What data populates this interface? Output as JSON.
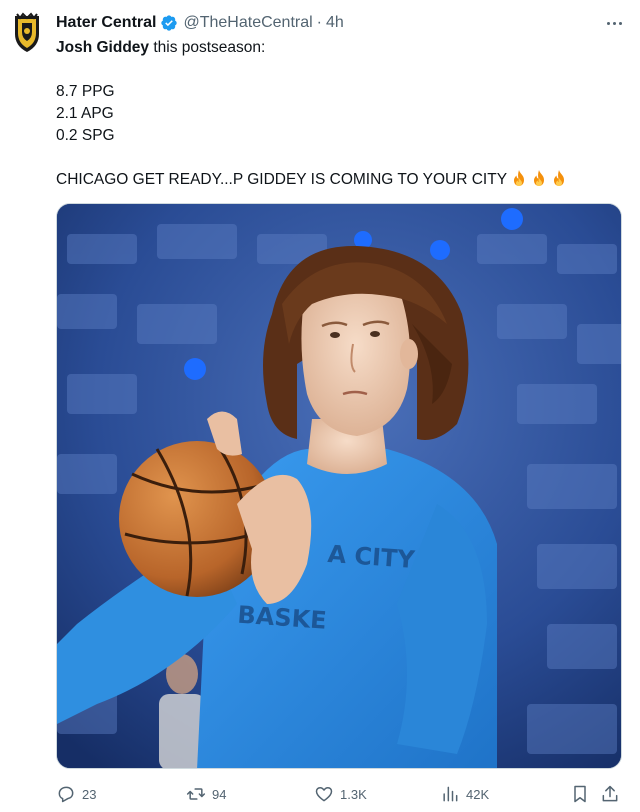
{
  "tweet": {
    "author_name": "Hater Central",
    "handle": "@TheHateCentral",
    "separator": "·",
    "time": "4h",
    "lines": {
      "lead_bold": "Josh Giddey",
      "lead_rest": " this postseason:",
      "stat1": "8.7 PPG",
      "stat2": "2.1 APG",
      "stat3": "0.2 SPG",
      "closing": "CHICAGO GET READY...P GIDDEY IS COMING TO YOUR CITY"
    },
    "emoji": [
      "fire-emoji",
      "fire-emoji",
      "fire-emoji"
    ],
    "media_description_icon": "photo",
    "photo_shirt_text": [
      "A CITY",
      "BASKE"
    ]
  },
  "actions": {
    "replies": "23",
    "retweets": "94",
    "likes": "1.3K",
    "views": "42K"
  },
  "icons": [
    "team-logo-icon",
    "verified-badge-icon",
    "more-options-icon",
    "reply-icon",
    "retweet-icon",
    "like-icon",
    "views-icon",
    "bookmark-icon",
    "share-icon"
  ],
  "colors": {
    "verified_blue": "#1d9bf0",
    "secondary_text": "#536471",
    "primary_text": "#0f1419",
    "shirt_blue": "#2f8fe0"
  }
}
